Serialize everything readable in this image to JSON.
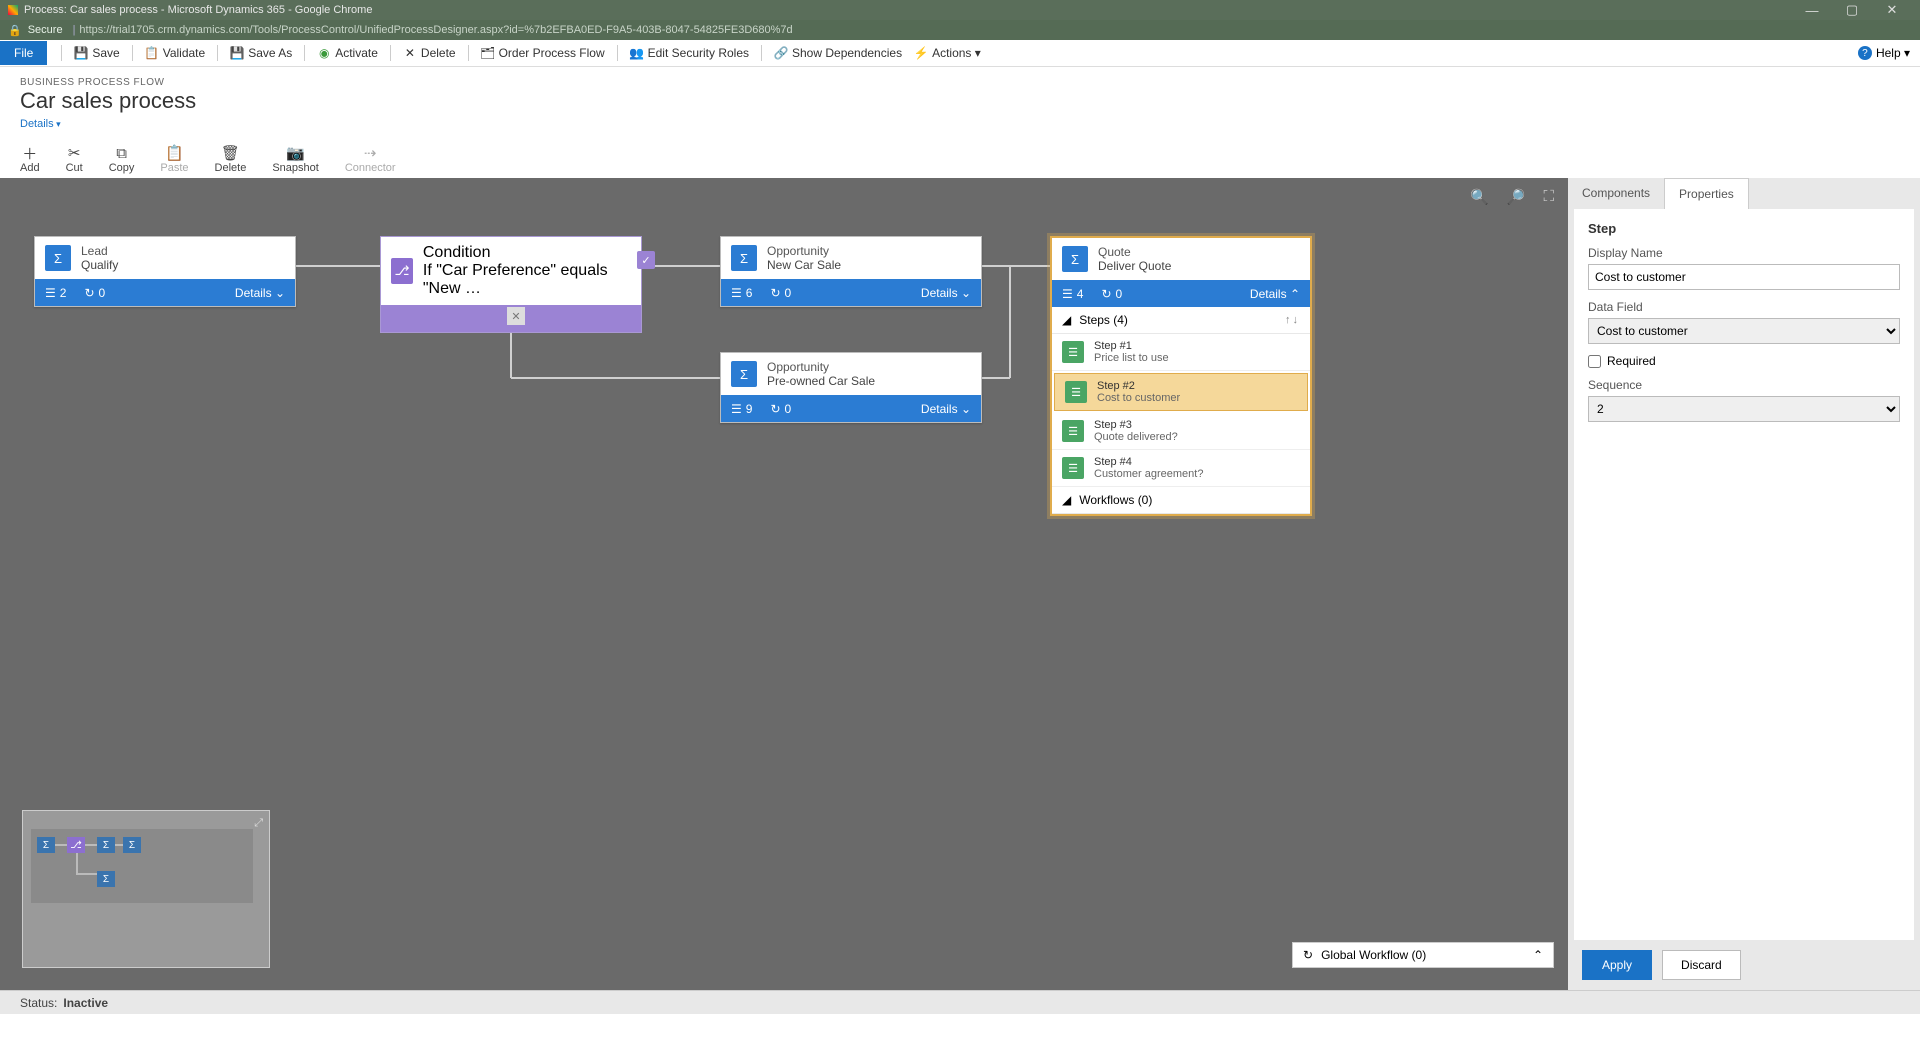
{
  "window": {
    "title": "Process: Car sales process - Microsoft Dynamics 365 - Google Chrome",
    "secure_label": "Secure",
    "url": "https://trial1705.crm.dynamics.com/Tools/ProcessControl/UnifiedProcessDesigner.aspx?id=%7b2EFBA0ED-F9A5-403B-8047-54825FE3D680%7d"
  },
  "toolbar": {
    "file": "File",
    "save": "Save",
    "validate": "Validate",
    "save_as": "Save As",
    "activate": "Activate",
    "delete": "Delete",
    "order": "Order Process Flow",
    "edit_roles": "Edit Security Roles",
    "show_deps": "Show Dependencies",
    "actions": "Actions ▾",
    "help": "Help ▾"
  },
  "header": {
    "breadcrumb": "BUSINESS PROCESS FLOW",
    "title": "Car sales process",
    "details": "Details"
  },
  "editbar": {
    "add": "Add",
    "cut": "Cut",
    "copy": "Copy",
    "paste": "Paste",
    "delete": "Delete",
    "snapshot": "Snapshot",
    "connector": "Connector"
  },
  "stages": {
    "lead": {
      "title": "Lead",
      "subtitle": "Qualify",
      "steps": "2",
      "loops": "0"
    },
    "cond": {
      "title": "Condition",
      "subtitle": "If \"Car Preference\" equals \"New …"
    },
    "opp_new": {
      "title": "Opportunity",
      "subtitle": "New Car Sale",
      "steps": "6",
      "loops": "0"
    },
    "opp_pre": {
      "title": "Opportunity",
      "subtitle": "Pre-owned Car Sale",
      "steps": "9",
      "loops": "0"
    },
    "quote": {
      "title": "Quote",
      "subtitle": "Deliver Quote",
      "steps": "4",
      "loops": "0"
    },
    "details_label": "Details",
    "steps_header": "Steps (4)",
    "workflows_header": "Workflows (0)",
    "quote_steps": [
      {
        "num": "Step #1",
        "name": "Price list to use"
      },
      {
        "num": "Step #2",
        "name": "Cost to customer"
      },
      {
        "num": "Step #3",
        "name": "Quote delivered?"
      },
      {
        "num": "Step #4",
        "name": "Customer agreement?"
      }
    ]
  },
  "global_workflow": "Global Workflow (0)",
  "sidepanel": {
    "tab_components": "Components",
    "tab_properties": "Properties",
    "heading": "Step",
    "display_name_label": "Display Name",
    "display_name_value": "Cost to customer",
    "data_field_label": "Data Field",
    "data_field_value": "Cost to customer",
    "required_label": "Required",
    "sequence_label": "Sequence",
    "sequence_value": "2",
    "apply": "Apply",
    "discard": "Discard"
  },
  "status": {
    "label": "Status:",
    "value": "Inactive"
  }
}
